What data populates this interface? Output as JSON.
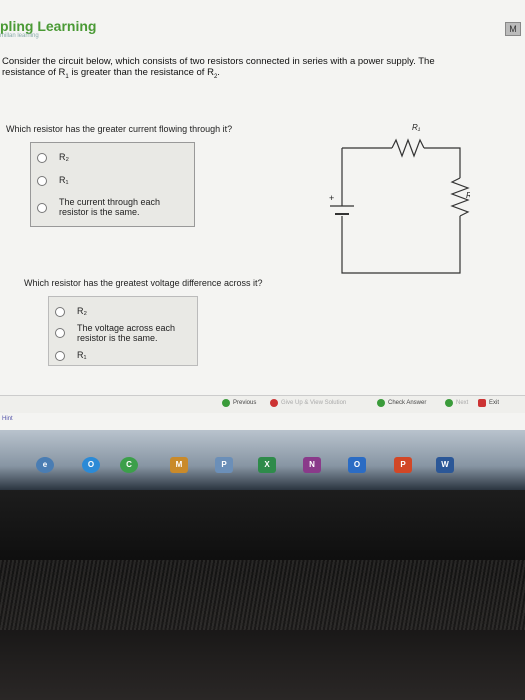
{
  "header": {
    "brand": "pling Learning",
    "brand_sub": "millan learning",
    "corner_btn": "M"
  },
  "intro": {
    "line1": "Consider the circuit below, which consists of two resistors connected in series with a power supply. The",
    "line2_pre": "resistance of R",
    "line2_sub1": "1",
    "line2_mid": " is greater than the resistance of R",
    "line2_sub2": "2",
    "line2_end": "."
  },
  "q1": {
    "prompt": "Which resistor has the greater current flowing through it?",
    "options": [
      {
        "label": "R₂"
      },
      {
        "label": "R₁"
      },
      {
        "label": "The current through each resistor is the same."
      }
    ]
  },
  "q2": {
    "prompt": "Which resistor has the greatest voltage difference across it?",
    "options": [
      {
        "label": "R₂"
      },
      {
        "label": "The voltage across each resistor is the same."
      },
      {
        "label": "R₁"
      }
    ]
  },
  "circuit": {
    "r1": "R₁",
    "r2": "R₂",
    "plus": "+"
  },
  "nav": {
    "previous": "Previous",
    "give_up": "Give Up & View Solution",
    "check": "Check Answer",
    "next": "Next",
    "exit": "Exit"
  },
  "hint": "Hint",
  "taskbar": {
    "icons": [
      "e",
      "O",
      "C",
      "M",
      "P",
      "X",
      "N",
      "O",
      "P",
      "W"
    ]
  }
}
